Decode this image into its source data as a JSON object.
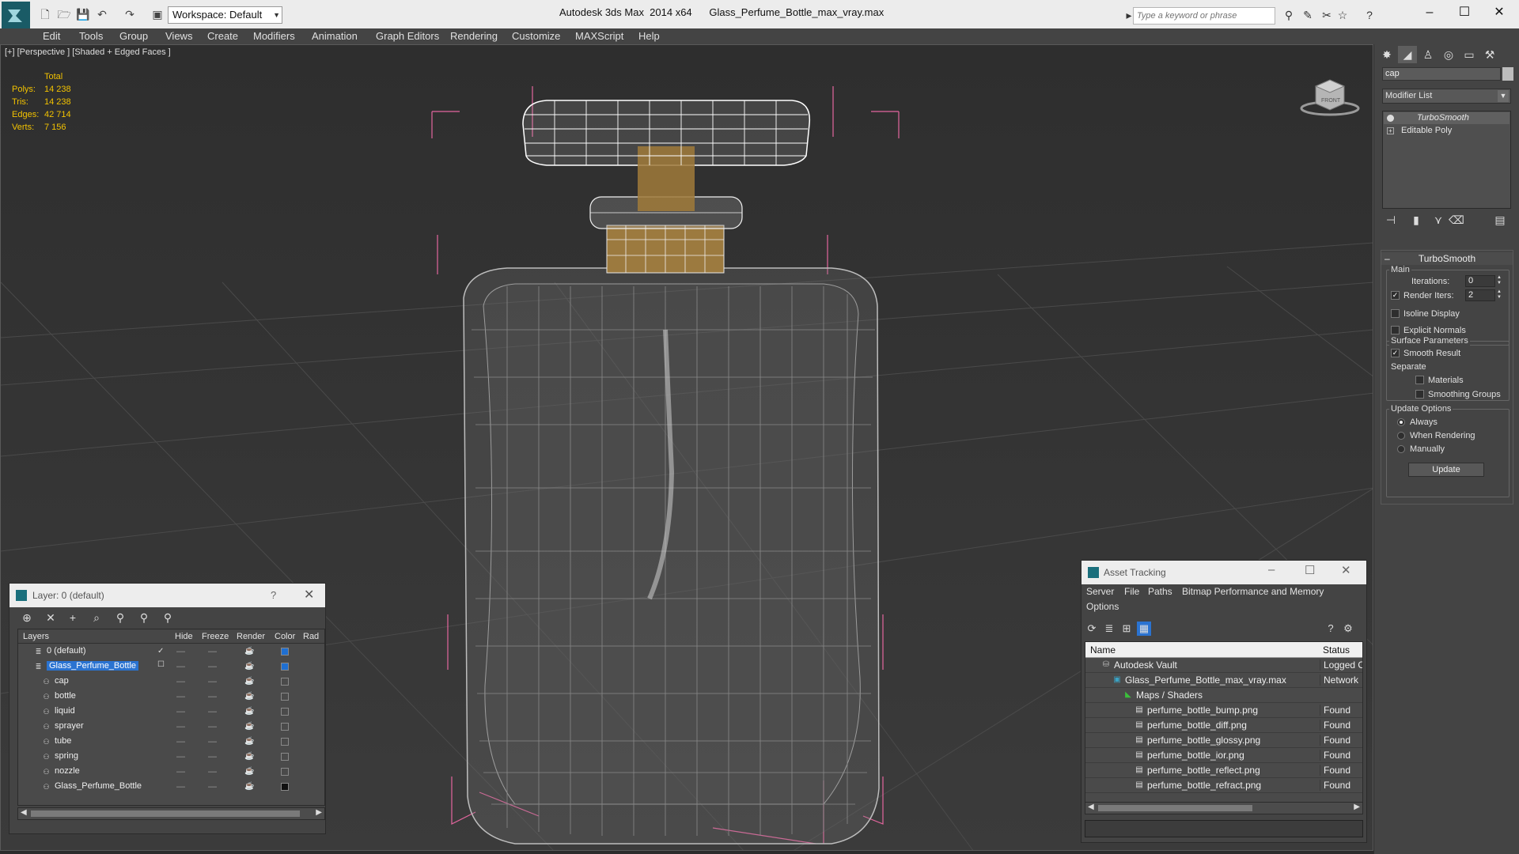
{
  "titlebar": {
    "workspace": "Workspace: Default",
    "app_title": "Autodesk 3ds Max  2014 x64",
    "file_title": "Glass_Perfume_Bottle_max_vray.max",
    "search_placeholder": "Type a keyword or phrase"
  },
  "menu": [
    "Edit",
    "Tools",
    "Group",
    "Views",
    "Create",
    "Modifiers",
    "Animation",
    "Graph Editors",
    "Rendering",
    "Customize",
    "MAXScript",
    "Help"
  ],
  "viewport": {
    "label": "[+] [Perspective ] [Shaded + Edged Faces ]",
    "stats": {
      "header": "Total",
      "rows": [
        {
          "k": "Polys:",
          "v": "14 238"
        },
        {
          "k": "Tris:",
          "v": "14 238"
        },
        {
          "k": "Edges:",
          "v": "42 714"
        },
        {
          "k": "Verts:",
          "v": "7 156"
        }
      ]
    },
    "viewcube_label": "FRONT",
    "colors": {
      "bounding_box": "#e4669f",
      "wire": "#c8c8c8",
      "cap_gold": "#a07a3a"
    }
  },
  "command_panel": {
    "object_name": "cap",
    "modifier_list": "Modifier List",
    "stack": [
      {
        "label": "TurboSmooth",
        "italic": true
      },
      {
        "label": "Editable Poly",
        "italic": false
      }
    ],
    "rollout": {
      "title": "TurboSmooth",
      "main_group": "Main",
      "iterations_label": "Iterations:",
      "iterations_value": "0",
      "render_iters_label": "Render Iters:",
      "render_iters_value": "2",
      "render_iters_checked": true,
      "isoline_label": "Isoline Display",
      "explicit_normals_label": "Explicit Normals",
      "surface_group": "Surface Parameters",
      "smooth_result_label": "Smooth Result",
      "separate_label": "Separate",
      "materials_label": "Materials",
      "smoothing_groups_label": "Smoothing Groups",
      "update_group": "Update Options",
      "always_label": "Always",
      "when_rendering_label": "When Rendering",
      "manually_label": "Manually",
      "update_button": "Update"
    }
  },
  "layer_manager": {
    "title": "Layer: 0 (default)",
    "help": "?",
    "columns": [
      "Layers",
      "Hide",
      "Freeze",
      "Render",
      "Color",
      "Rad"
    ],
    "rows": [
      {
        "name": "0 (default)",
        "indent": 0,
        "type": "layer",
        "current": true,
        "color": "#1f6fd1"
      },
      {
        "name": "Glass_Perfume_Bottle",
        "indent": 0,
        "type": "layer",
        "selected": true,
        "color": "#1f6fd1"
      },
      {
        "name": "cap",
        "indent": 1,
        "type": "object",
        "color": "#4a4a4a"
      },
      {
        "name": "bottle",
        "indent": 1,
        "type": "object",
        "color": "#4a4a4a"
      },
      {
        "name": "liquid",
        "indent": 1,
        "type": "object",
        "color": "#4a4a4a"
      },
      {
        "name": "sprayer",
        "indent": 1,
        "type": "object",
        "color": "#4a4a4a"
      },
      {
        "name": "tube",
        "indent": 1,
        "type": "object",
        "color": "#4a4a4a"
      },
      {
        "name": "spring",
        "indent": 1,
        "type": "object",
        "color": "#4a4a4a"
      },
      {
        "name": "nozzle",
        "indent": 1,
        "type": "object",
        "color": "#4a4a4a"
      },
      {
        "name": "Glass_Perfume_Bottle",
        "indent": 1,
        "type": "object",
        "color": "#111111"
      }
    ]
  },
  "asset_tracking": {
    "title": "Asset Tracking",
    "menu": [
      "Server",
      "File",
      "Paths",
      "Bitmap Performance and Memory",
      "Options"
    ],
    "columns": [
      "Name",
      "Status"
    ],
    "rows": [
      {
        "name": "Autodesk Vault",
        "indent": 1,
        "icon": "vault",
        "status": "Logged O"
      },
      {
        "name": "Glass_Perfume_Bottle_max_vray.max",
        "indent": 2,
        "icon": "max",
        "status": "Network"
      },
      {
        "name": "Maps / Shaders",
        "indent": 3,
        "icon": "maps",
        "status": ""
      },
      {
        "name": "perfume_bottle_bump.png",
        "indent": 4,
        "icon": "file",
        "status": "Found"
      },
      {
        "name": "perfume_bottle_diff.png",
        "indent": 4,
        "icon": "file",
        "status": "Found"
      },
      {
        "name": "perfume_bottle_glossy.png",
        "indent": 4,
        "icon": "file",
        "status": "Found"
      },
      {
        "name": "perfume_bottle_ior.png",
        "indent": 4,
        "icon": "file",
        "status": "Found"
      },
      {
        "name": "perfume_bottle_reflect.png",
        "indent": 4,
        "icon": "file",
        "status": "Found"
      },
      {
        "name": "perfume_bottle_refract.png",
        "indent": 4,
        "icon": "file",
        "status": "Found"
      }
    ]
  }
}
